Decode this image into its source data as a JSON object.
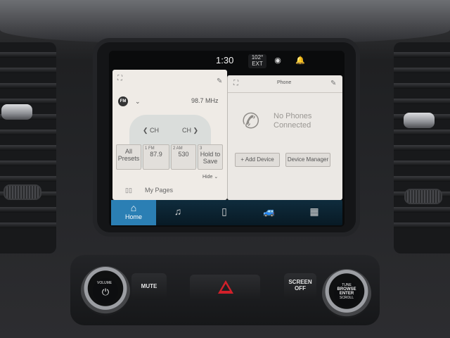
{
  "status": {
    "time": "1:30",
    "temp_value": "102°",
    "temp_label": "EXT",
    "voice_icon": "voice-assistant-icon",
    "notification_icon": "bell-icon"
  },
  "radio": {
    "band_logo": "FM",
    "frequency": "98.7 MHz",
    "ch_prev": "CH",
    "ch_next": "CH",
    "all_presets_line1": "All",
    "all_presets_line2": "Presets",
    "presets": [
      {
        "label": "1 FM",
        "value": "87.9"
      },
      {
        "label": "2 AM",
        "value": "530"
      },
      {
        "label": "3",
        "value_line1": "Hold to",
        "value_line2": "Save"
      }
    ],
    "hide_label": "Hide",
    "my_pages_label": "My Pages"
  },
  "phone": {
    "title": "Phone",
    "status_line1": "No Phones",
    "status_line2": "Connected",
    "add_device_label": "+ Add Device",
    "device_manager_label": "Device Manager"
  },
  "nav": {
    "home_label": "Home",
    "items": [
      "music-icon",
      "phone-icon",
      "vehicle-icon",
      "apps-grid-icon"
    ]
  },
  "hardware": {
    "volume_label": "VOLUME",
    "mute_label": "MUTE",
    "screen_off_line1": "SCREEN",
    "screen_off_line2": "OFF",
    "tune_line1": "TUNE",
    "tune_line2": "BROWSE",
    "tune_line3": "ENTER",
    "tune_line4": "SCROLL"
  }
}
